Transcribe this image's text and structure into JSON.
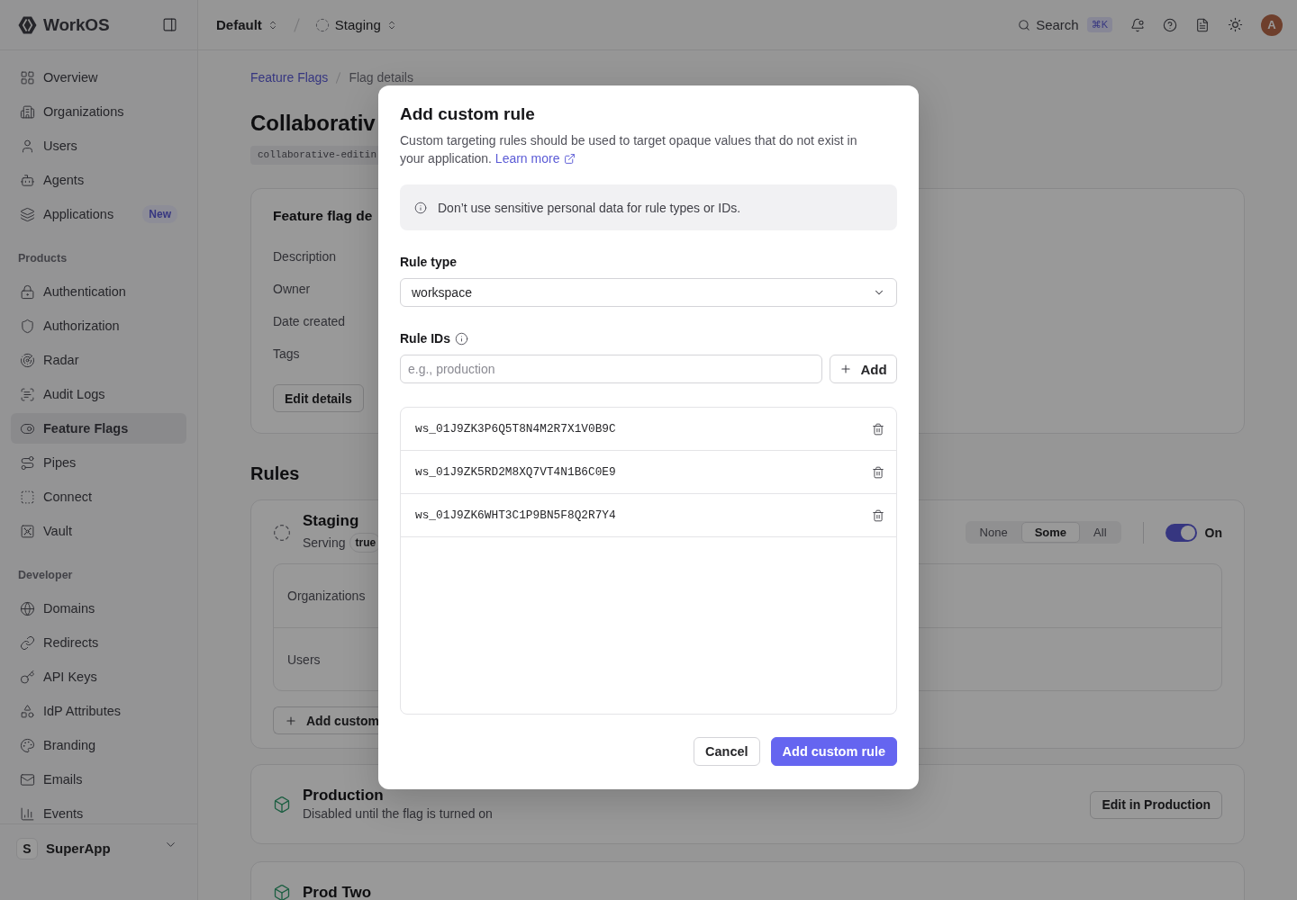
{
  "sidebar": {
    "brand": "WorkOS",
    "groups": [
      {
        "items": [
          {
            "label": "Overview",
            "selected": false
          },
          {
            "label": "Organizations",
            "selected": false
          },
          {
            "label": "Users",
            "selected": false
          },
          {
            "label": "Agents",
            "selected": false
          },
          {
            "label": "Applications",
            "selected": false,
            "badge": "New"
          }
        ]
      },
      {
        "heading": "Products",
        "items": [
          {
            "label": "Authentication",
            "selected": false
          },
          {
            "label": "Authorization",
            "selected": false
          },
          {
            "label": "Radar",
            "selected": false
          },
          {
            "label": "Audit Logs",
            "selected": false
          },
          {
            "label": "Feature Flags",
            "selected": true
          },
          {
            "label": "Pipes",
            "selected": false
          },
          {
            "label": "Connect",
            "selected": false
          },
          {
            "label": "Vault",
            "selected": false
          }
        ]
      },
      {
        "heading": "Developer",
        "items": [
          {
            "label": "Domains",
            "selected": false
          },
          {
            "label": "Redirects",
            "selected": false
          },
          {
            "label": "API Keys",
            "selected": false
          },
          {
            "label": "IdP Attributes",
            "selected": false
          },
          {
            "label": "Branding",
            "selected": false
          },
          {
            "label": "Emails",
            "selected": false
          },
          {
            "label": "Events",
            "selected": false
          }
        ]
      }
    ],
    "workspace": {
      "initial": "S",
      "name": "SuperApp"
    }
  },
  "topbar": {
    "switchers": [
      {
        "label": "Default",
        "kind": "team"
      },
      {
        "label": "Staging",
        "kind": "environment"
      }
    ],
    "search": {
      "label": "Search",
      "shortcut": "⌘K"
    },
    "avatar": "A"
  },
  "page": {
    "breadcrumb": [
      {
        "label": "Feature Flags",
        "kind": "link"
      },
      {
        "label": "Flag details",
        "kind": "current"
      }
    ],
    "title": "Collaborativ",
    "slug": "collaborative-editin",
    "details": {
      "title": "Feature flag de",
      "fields": [
        "Description",
        "Owner",
        "Date created",
        "Tags"
      ],
      "button": "Edit details"
    },
    "rules": {
      "heading": "Rules",
      "environments": [
        {
          "kind": "preview",
          "name": "Staging",
          "serving_label": "Serving",
          "serving_value": "true",
          "segments": [
            {
              "label": "None",
              "selected": false
            },
            {
              "label": "Some",
              "selected": true
            },
            {
              "label": "All",
              "selected": false
            }
          ],
          "toggle": {
            "on": true,
            "label": "On"
          },
          "targets": [
            "Organizations",
            "Users"
          ],
          "add_button": "Add custom"
        },
        {
          "kind": "live",
          "name": "Production",
          "note": "Disabled until the flag is turned on",
          "button": "Edit in Production"
        },
        {
          "kind": "live",
          "name": "Prod Two"
        }
      ]
    }
  },
  "modal": {
    "title": "Add custom rule",
    "description": "Custom targeting rules should be used to target opaque values that do not exist in your application.",
    "link": "Learn more",
    "notice": "Don’t use sensitive personal data for rule types or IDs.",
    "rule_type": {
      "label": "Rule type",
      "value": "workspace"
    },
    "rule_ids": {
      "label": "Rule IDs",
      "placeholder": "e.g., production",
      "add_button": "Add",
      "items": [
        "ws_01J9ZK3P6Q5T8N4M2R7X1V0B9C",
        "ws_01J9ZK5RD2M8XQ7VT4N1B6C0E9",
        "ws_01J9ZK6WHT3C1P9BN5F8Q2R7Y4"
      ]
    },
    "buttons": [
      {
        "label": "Cancel",
        "kind": "secondary"
      },
      {
        "label": "Add custom rule",
        "kind": "primary"
      }
    ]
  }
}
